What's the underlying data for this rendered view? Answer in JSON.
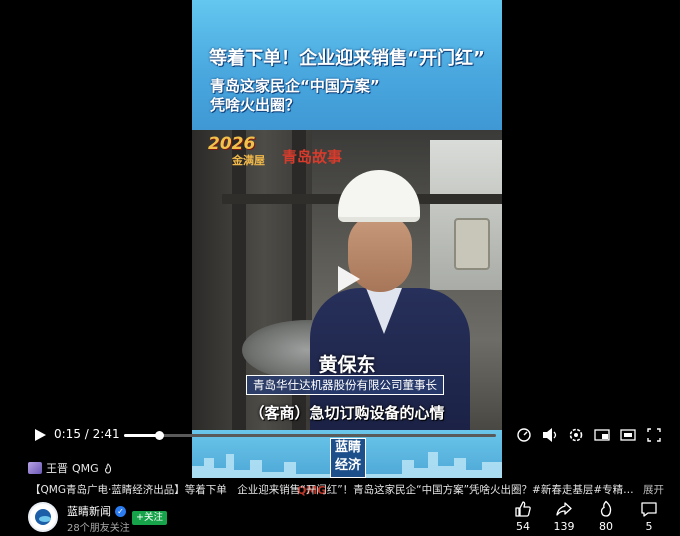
{
  "video": {
    "banner_line1": "等着下单！企业迎来销售“开门红”",
    "banner_line2": "青岛这家民企“中国方案”",
    "banner_line3": "凭啥火出圈？",
    "logo_year": "2026",
    "logo_text": "金满屋",
    "logo_red": "青岛故事",
    "person_name": "黄保东",
    "person_title": "青岛华仕达机器股份有限公司董事长",
    "subtitle": "（客商）急切订购设备的心情",
    "station_logo": "蓝睛经济",
    "qmg_mark": "QMG"
  },
  "player": {
    "current_time": "0:15",
    "separator": "/",
    "duration": "2:41",
    "progress_fraction": 0.093
  },
  "author": {
    "name": "王晋",
    "tag": "QMG"
  },
  "description": "【QMG青岛广电·蓝睛经济出品】等着下单　企业迎来销售“开门红”！青岛这家民企“中国方案”凭啥火出圈？#新春走基层#专精…",
  "expand_label": "展开",
  "channel": {
    "name": "蓝睛新闻",
    "follow_label": "+关注",
    "friends_text": "28个朋友关注"
  },
  "stats": {
    "likes": "54",
    "shares": "139",
    "recommends": "80",
    "comments": "5"
  }
}
